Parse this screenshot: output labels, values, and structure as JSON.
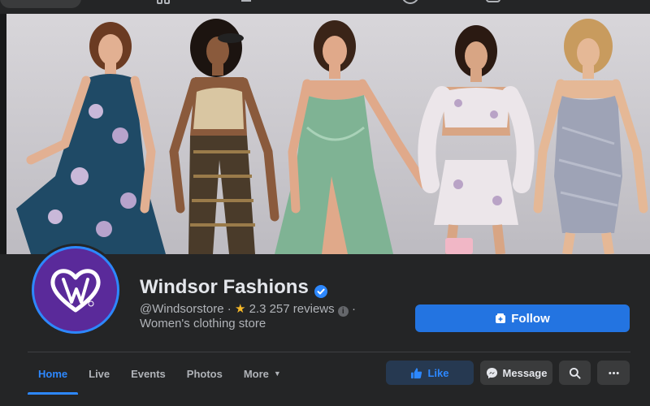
{
  "page": {
    "name": "Windsor Fashions",
    "handle": "@Windsorstore",
    "rating": "2.3",
    "reviews": "257 reviews",
    "category": "Women's clothing store",
    "verified": true
  },
  "actions": {
    "follow_label": "Follow",
    "like_label": "Like",
    "message_label": "Message"
  },
  "tabs": [
    {
      "label": "Home",
      "active": true
    },
    {
      "label": "Live"
    },
    {
      "label": "Events"
    },
    {
      "label": "Photos"
    },
    {
      "label": "More"
    }
  ],
  "icons": {
    "verified": "verified-badge-icon",
    "star": "star-icon",
    "info": "info-icon",
    "follow": "follow-icon",
    "like": "thumbs-up-icon",
    "message": "messenger-icon",
    "search": "search-icon",
    "more": "ellipsis-icon"
  },
  "colors": {
    "accent": "#2374e1",
    "link_blue": "#2d88ff",
    "star": "#f7b928",
    "background": "#18191a",
    "surface": "#242526",
    "logo_purple": "#5a2a9a"
  }
}
